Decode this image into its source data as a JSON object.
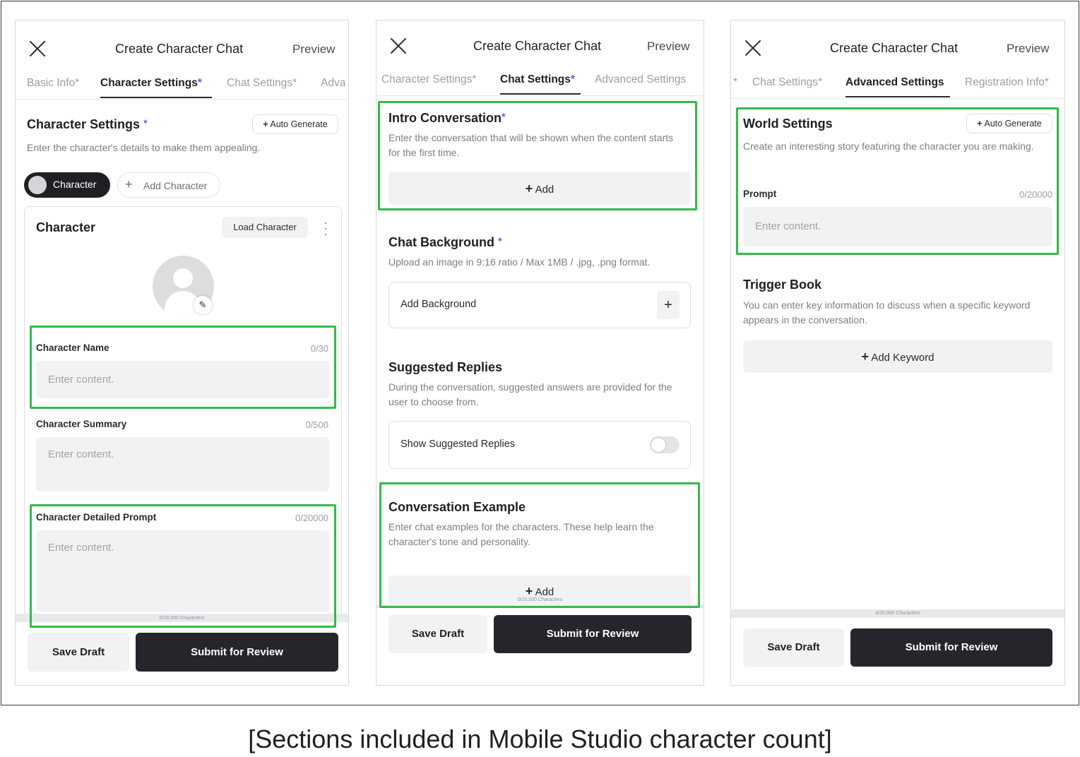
{
  "caption": "[Sections included in Mobile Studio character count]",
  "colors": {
    "highlight": "#37b84a",
    "accent_star": "#5b5fee",
    "primary_button": "#24262b",
    "field_bg": "#f1f2f3"
  },
  "screens": [
    {
      "header": {
        "title": "Create Character Chat",
        "preview": "Preview"
      },
      "tabs": [
        {
          "label": "Basic Info",
          "star": "*"
        },
        {
          "label": "Character Settings",
          "star": "*"
        },
        {
          "label": "Chat Settings",
          "star": "*"
        },
        {
          "label": "Adva",
          "star": ""
        }
      ],
      "section": {
        "title": "Character Settings",
        "star": "*",
        "auto_generate": "Auto Generate",
        "description": "Enter the character's details to make them appealing."
      },
      "character_chip": "Character",
      "add_character": "Add Character",
      "card": {
        "title": "Character",
        "load_button": "Load Character"
      },
      "fields": {
        "name": {
          "label": "Character Name",
          "count": "0/30",
          "placeholder": "Enter content."
        },
        "summary": {
          "label": "Character Summary",
          "count": "0/500",
          "placeholder": "Enter content."
        },
        "prompt": {
          "label": "Character Detailed Prompt",
          "count": "0/20000",
          "placeholder": "Enter content."
        }
      },
      "char_counter": "0/20,000 Characters",
      "save_draft": "Save Draft",
      "submit": "Submit for Review"
    },
    {
      "header": {
        "title": "Create Character Chat",
        "preview": "Preview"
      },
      "tabs": [
        {
          "label": "Character Settings",
          "star": "*"
        },
        {
          "label": "Chat Settings",
          "star": "*"
        },
        {
          "label": "Advanced Settings",
          "star": ""
        }
      ],
      "intro": {
        "title": "Intro Conversation",
        "star": "*",
        "description": "Enter the conversation that will be shown when the content starts for the first time.",
        "add": "Add"
      },
      "background": {
        "title": "Chat Background",
        "star": "*",
        "description": "Upload an image in 9:16 ratio / Max 1MB / .jpg, .png format.",
        "add_label": "Add Background"
      },
      "suggested": {
        "title": "Suggested Replies",
        "description": "During the conversation, suggested answers are provided for the user to choose from.",
        "toggle_label": "Show Suggested Replies",
        "toggle_on": false
      },
      "example": {
        "title": "Conversation Example",
        "description": "Enter chat examples for the characters. These help learn the character's tone and personality.",
        "add": "Add"
      },
      "char_counter": "0/20,000 Characters",
      "save_draft": "Save Draft",
      "submit": "Submit for Review"
    },
    {
      "header": {
        "title": "Create Character Chat",
        "preview": "Preview"
      },
      "tabs": [
        {
          "label": "",
          "star": "*"
        },
        {
          "label": "Chat Settings",
          "star": "*"
        },
        {
          "label": "Advanced Settings",
          "star": ""
        },
        {
          "label": "Registration Info",
          "star": "*"
        }
      ],
      "world": {
        "title": "World Settings",
        "auto_generate": "Auto Generate",
        "description": "Create an interesting story featuring the character you are making.",
        "prompt_label": "Prompt",
        "prompt_count": "0/20000",
        "placeholder": "Enter content."
      },
      "trigger": {
        "title": "Trigger Book",
        "description": "You can enter key information to discuss when a specific keyword appears in the conversation.",
        "add_keyword": "Add Keyword"
      },
      "char_counter": "0/20,000 Characters",
      "save_draft": "Save Draft",
      "submit": "Submit for Review"
    }
  ]
}
